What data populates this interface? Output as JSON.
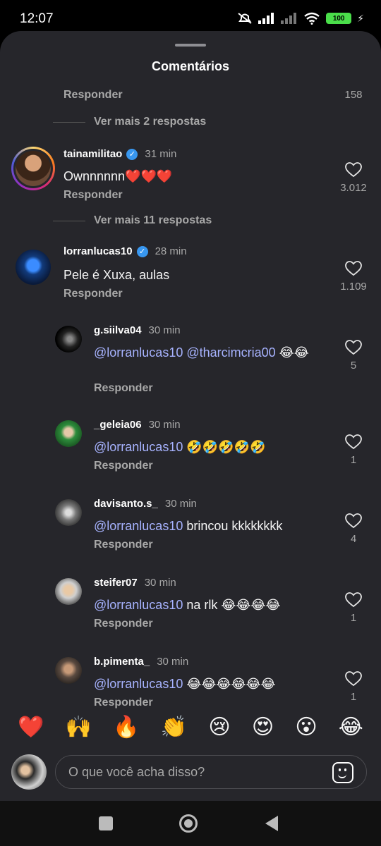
{
  "status": {
    "time": "12:07",
    "battery": "100"
  },
  "sheet": {
    "title": "Comentários"
  },
  "top_fragment": {
    "reply_label": "Responder",
    "likes": "158"
  },
  "more_replies_1": "Ver mais 2 respostas",
  "more_replies_2": "Ver mais 11 respostas",
  "comments": [
    {
      "username": "tainamilitao",
      "verified": true,
      "time": "31 min",
      "text": "Ownnnnnn❤️❤️❤️",
      "reply_label": "Responder",
      "likes": "3.012"
    },
    {
      "username": "lorranlucas10",
      "verified": true,
      "time": "28 min",
      "text": "Pele é Xuxa, aulas",
      "reply_label": "Responder",
      "likes": "1.109"
    }
  ],
  "replies": [
    {
      "username": "g.siilva04",
      "time": "30 min",
      "mention": "@lorranlucas10 @tharcimcria00",
      "text": " 😂😂",
      "reply_label": "Responder",
      "likes": "5"
    },
    {
      "username": "_geleia06",
      "time": "30 min",
      "mention": "@lorranlucas10",
      "text": " 🤣🤣🤣🤣🤣",
      "reply_label": "Responder",
      "likes": "1"
    },
    {
      "username": "davisanto.s_",
      "time": "30 min",
      "mention": "@lorranlucas10",
      "text": " brincou kkkkkkkk",
      "reply_label": "Responder",
      "likes": "4"
    },
    {
      "username": "steifer07",
      "time": "30 min",
      "mention": "@lorranlucas10",
      "text": " na rlk 😂😂😂😂",
      "reply_label": "Responder",
      "likes": "1"
    },
    {
      "username": "b.pimenta_",
      "time": "30 min",
      "mention": "@lorranlucas10",
      "text": " 😂😂😂😂😂😂",
      "reply_label": "Responder",
      "likes": "1"
    }
  ],
  "reactions": [
    "❤️",
    "🙌",
    "🔥",
    "👏",
    "😢",
    "😍",
    "😮",
    "😂"
  ],
  "composer": {
    "placeholder": "O que você acha disso?"
  },
  "icons": {
    "like": "heart-icon",
    "verified": "verified-badge-icon",
    "sticker": "sticker-icon"
  }
}
